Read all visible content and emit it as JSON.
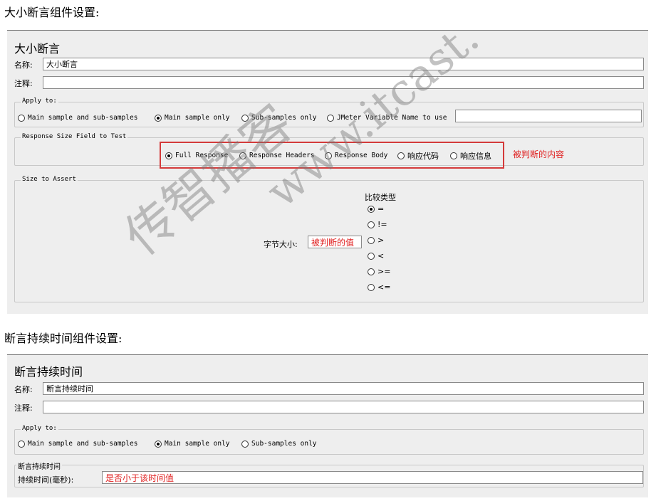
{
  "heading1": "大小断言组件设置:",
  "heading2": "断言持续时间组件设置:",
  "size_panel": {
    "title": "大小断言",
    "name_label": "名称:",
    "name_value": "大小断言",
    "comment_label": "注释:",
    "comment_value": "",
    "apply_to": {
      "legend": "Apply to:",
      "options": [
        "Main sample and sub-samples",
        "Main sample only",
        "Sub-samples only",
        "JMeter Variable Name to use"
      ],
      "selected": "Main sample only",
      "variable_value": ""
    },
    "response_field": {
      "legend": "Response Size Field to Test",
      "options": [
        "Full Response",
        "Response Headers",
        "Response Body",
        "响应代码",
        "响应信息"
      ],
      "selected": "Full Response",
      "annotation": "被判断的内容"
    },
    "size_to_assert": {
      "legend": "Size to Assert",
      "compare_label": "比较类型",
      "operators": [
        "=",
        "!=",
        ">",
        "<",
        ">=",
        "<="
      ],
      "selected": "=",
      "byte_size_label": "字节大小:",
      "byte_size_value": "被判断的值"
    }
  },
  "duration_panel": {
    "title": "断言持续时间",
    "name_label": "名称:",
    "name_value": "断言持续时间",
    "comment_label": "注释:",
    "comment_value": "",
    "apply_to": {
      "legend": "Apply to:",
      "options": [
        "Main sample and sub-samples",
        "Main sample only",
        "Sub-samples only"
      ],
      "selected": "Main sample only"
    },
    "duration_section": {
      "legend": "断言持续时间",
      "label": "持续时间(毫秒):",
      "value": "是否小于该时间值"
    }
  },
  "watermark": {
    "text_cn": "传智播客",
    "text_url": "www.itcast."
  },
  "colors": {
    "panel_bg": "#eeeeee",
    "annotation_red": "#e02020",
    "highlight_box": "#d43a3a"
  }
}
